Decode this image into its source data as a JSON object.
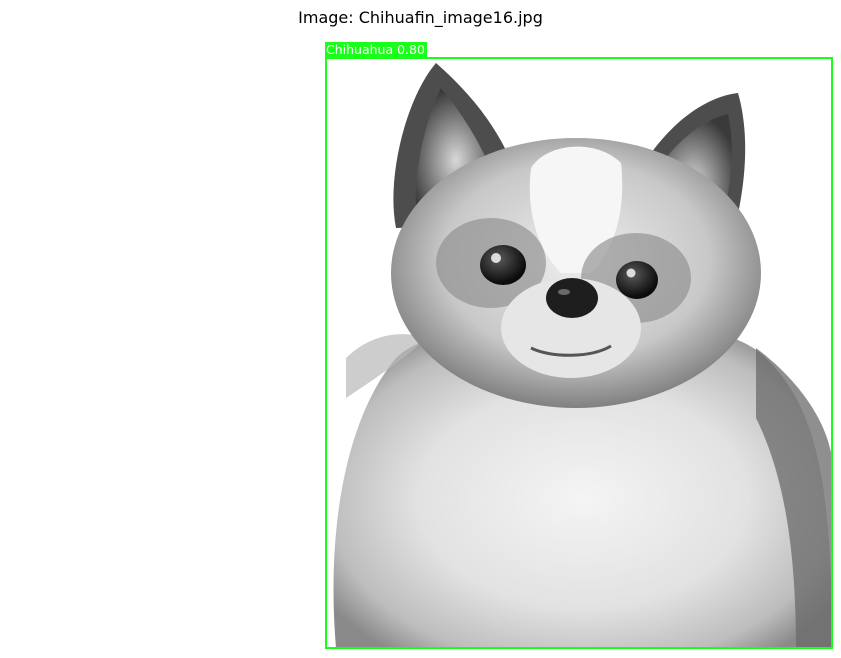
{
  "figure": {
    "title": "Image: Chihuafin_image16.jpg"
  },
  "photo": {
    "subject": "long-haired chihuahua, black-and-white portrait"
  },
  "detections": [
    {
      "label": "Chihuahua 0.80",
      "class": "Chihuahua",
      "score": 0.8,
      "color": "#1aff1a"
    }
  ],
  "colors": {
    "background": "#ffffff",
    "box": "#1aff1a",
    "label_text": "#ffffff"
  }
}
